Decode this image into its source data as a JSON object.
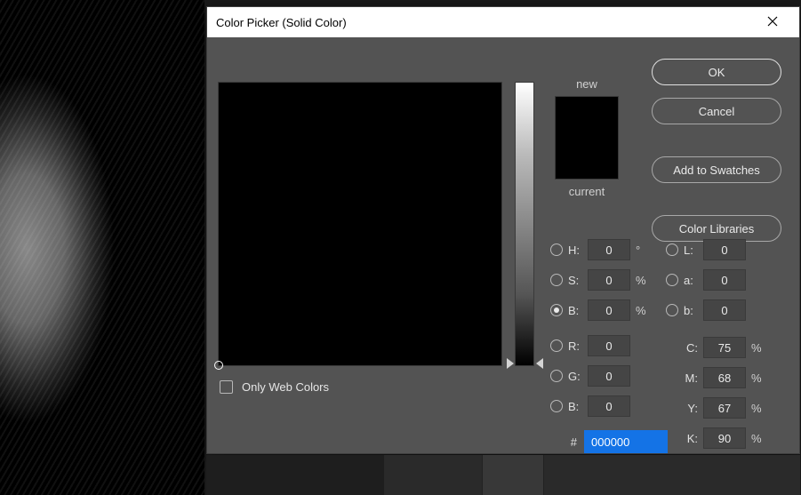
{
  "dialog": {
    "title": "Color Picker (Solid Color)",
    "buttons": {
      "ok": "OK",
      "cancel": "Cancel",
      "add_swatches": "Add to Swatches",
      "color_libraries": "Color Libraries"
    },
    "swatch": {
      "new_label": "new",
      "current_label": "current"
    },
    "web_colors_label": "Only Web Colors",
    "hsb": {
      "h_label": "H:",
      "h_value": "0",
      "h_unit": "°",
      "s_label": "S:",
      "s_value": "0",
      "s_unit": "%",
      "b_label": "B:",
      "b_value": "0",
      "b_unit": "%"
    },
    "lab": {
      "l_label": "L:",
      "l_value": "0",
      "a_label": "a:",
      "a_value": "0",
      "b_label": "b:",
      "b_value": "0"
    },
    "rgb": {
      "r_label": "R:",
      "r_value": "0",
      "g_label": "G:",
      "g_value": "0",
      "b_label": "B:",
      "b_value": "0"
    },
    "cmyk": {
      "c_label": "C:",
      "c_value": "75",
      "c_unit": "%",
      "m_label": "M:",
      "m_value": "68",
      "m_unit": "%",
      "y_label": "Y:",
      "y_value": "67",
      "y_unit": "%",
      "k_label": "K:",
      "k_value": "90",
      "k_unit": "%"
    },
    "hex": {
      "label": "#",
      "value": "000000"
    },
    "colors": {
      "new": "#000000",
      "current": "#000000"
    }
  }
}
